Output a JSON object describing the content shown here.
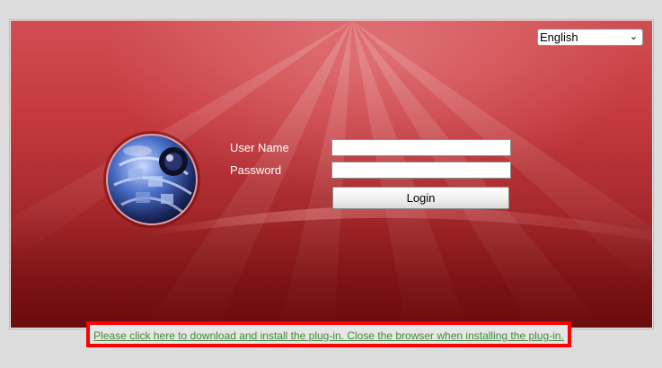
{
  "header": {
    "language_select": {
      "value": "English",
      "chevron_icon": "chevron-down-icon"
    }
  },
  "login_form": {
    "username_label": "User Name",
    "username_value": "",
    "password_label": "Password",
    "password_value": "",
    "login_label": "Login"
  },
  "footer": {
    "plugin_link": "Please click here to download and install the plug-in. Close the browser when installing the plug-in."
  },
  "colors": {
    "panel_red": "#c63a3f",
    "panel_dark_red": "#6a0c0e",
    "highlight_border": "#ff0000",
    "link_green": "#3f8a3c"
  }
}
